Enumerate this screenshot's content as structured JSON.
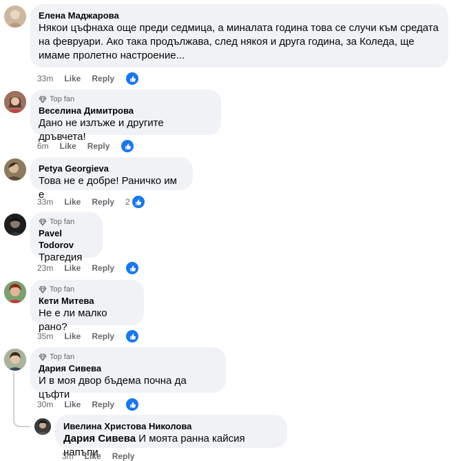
{
  "comments": [
    {
      "name": "Елена Маджарова",
      "top_fan": false,
      "lines": [
        "Някои цъфнаха още преди седмица, а миналата година това се случи към средата",
        "на февруари. Ако така продължава, след някоя и друга година, за Коледа, ще",
        "имаме пролетно настроение..."
      ],
      "time": "33m",
      "like": "Like",
      "reply": "Reply",
      "reactions": "",
      "avatar_color": "#cdb79e"
    },
    {
      "name": "Веселина Димитрова",
      "top_fan": true,
      "top_fan_label": "Top fan",
      "lines": [
        "Дано не излъже и другите дръвчета!"
      ],
      "time": "6m",
      "like": "Like",
      "reply": "Reply",
      "reactions": "",
      "avatar_color": "#8a5a4a"
    },
    {
      "name": "Petya Georgieva",
      "top_fan": false,
      "lines": [
        "Това не е добре! Раничко им е"
      ],
      "time": "33m",
      "like": "Like",
      "reply": "Reply",
      "reactions": "2",
      "avatar_color": "#7a6a55"
    },
    {
      "name": "Pavel Todorov",
      "top_fan": true,
      "top_fan_label": "Top fan",
      "lines": [
        "Трагедия"
      ],
      "time": "23m",
      "like": "Like",
      "reply": "Reply",
      "reactions": "",
      "avatar_color": "#2e2e2e"
    },
    {
      "name": "Кети Митева",
      "top_fan": true,
      "top_fan_label": "Top fan",
      "lines": [
        "Не е ли малко рано?"
      ],
      "time": "35m",
      "like": "Like",
      "reply": "Reply",
      "reactions": "",
      "avatar_color": "#a0443a"
    },
    {
      "name": "Дария Сивева",
      "top_fan": true,
      "top_fan_label": "Top fan",
      "lines": [
        "И в моя двор бъдема почна да цъфти"
      ],
      "time": "30m",
      "like": "Like",
      "reply": "Reply",
      "reactions": "",
      "avatar_color": "#6b7a5a"
    }
  ],
  "reply": {
    "name": "Ивелина Христова Николова",
    "mention": "Дария Сивева",
    "text": " И моята ранна кайсия напъпи.",
    "time": "3m",
    "like": "Like",
    "reply": "Reply",
    "avatar_color": "#4a4a4a"
  },
  "icons": {
    "top_fan_icon": "diamond-icon",
    "reaction_icon": "thumbs-up-icon"
  },
  "colors": {
    "bubble": "#f0f2f5",
    "like_blue": "#1877f2",
    "meta_gray": "#65676b"
  }
}
